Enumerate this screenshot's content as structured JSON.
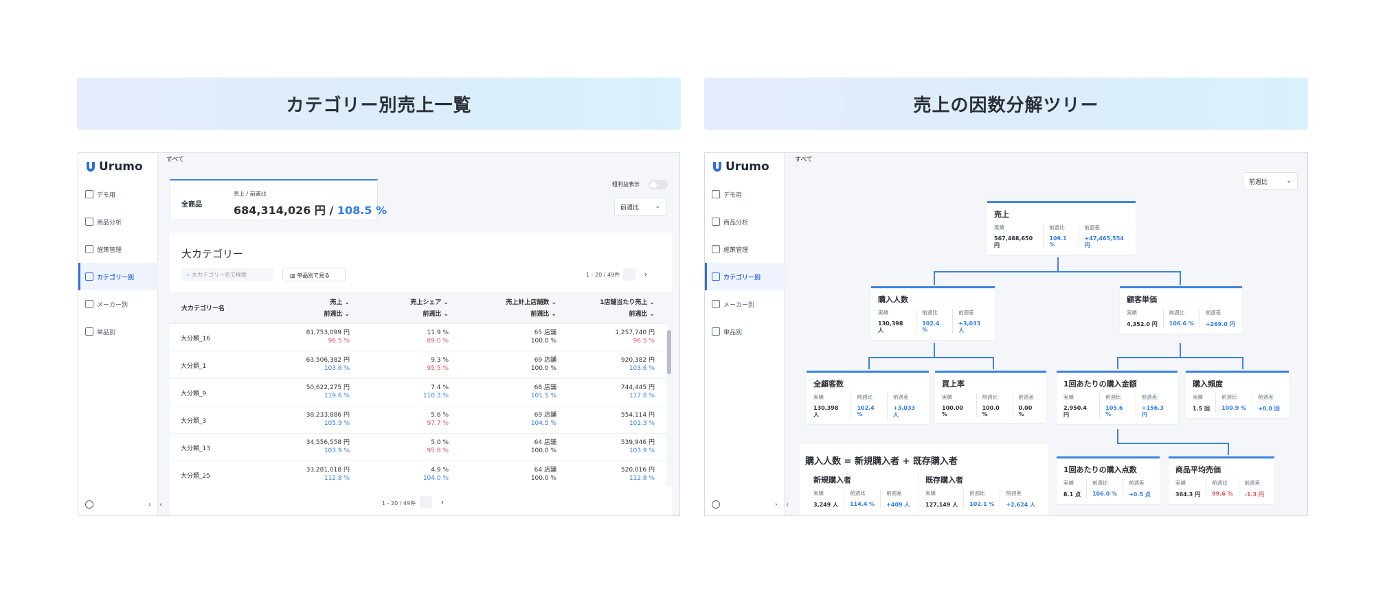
{
  "titles": {
    "left": "カテゴリー別売上一覧",
    "right": "売上の因数分解ツリー"
  },
  "colors": {
    "accent": "#2f7be8",
    "negative": "#e0505a",
    "title_bg": "#e1eefb"
  },
  "app": {
    "logo": "Urumo",
    "breadcrumb": "すべて",
    "nav": [
      {
        "label": "デモ用",
        "icon": "document-icon"
      },
      {
        "label": "商品分析",
        "icon": "chart-icon"
      },
      {
        "label": "施策管理",
        "icon": "megaphone-icon"
      },
      {
        "label": "カテゴリー別",
        "icon": "category-icon",
        "active": true
      },
      {
        "label": "メーカー別",
        "icon": "factory-icon"
      },
      {
        "label": "単品別",
        "icon": "barcode-icon"
      }
    ]
  },
  "left": {
    "summary": {
      "label": "全商品",
      "metric_label": "売上 / 前週比",
      "value": "684,314,026 円 / ",
      "ratio": "108.5 %"
    },
    "toggle_label": "粗利益表示",
    "compare_select": "前週比",
    "section_title": "大カテゴリー",
    "search_placeholder": "大カテゴリー名で検索",
    "by_item_button": "単品別で見る",
    "pagination": "1 - 20 / 49件",
    "pagination_bottom": "1 - 20 / 49件",
    "headers": {
      "name": "大カテゴリー名",
      "cols": [
        {
          "top": "売上",
          "bottom": "前週比"
        },
        {
          "top": "売上シェア",
          "bottom": "前週比"
        },
        {
          "top": "売上計上店舗数",
          "bottom": "前週比"
        },
        {
          "top": "1店舗当たり売上",
          "bottom": "前週比"
        }
      ]
    },
    "rows": [
      {
        "name": "大分類_16",
        "c": [
          [
            "81,753,099 円",
            "96.5 %",
            "red"
          ],
          [
            "11.9 %",
            "89.0 %",
            "red"
          ],
          [
            "65 店舗",
            "100.0 %",
            ""
          ],
          [
            "1,257,740 円",
            "96.5 %",
            "red"
          ]
        ]
      },
      {
        "name": "大分類_1",
        "c": [
          [
            "63,506,382 円",
            "103.6 %",
            "blue"
          ],
          [
            "9.3 %",
            "95.5 %",
            "red"
          ],
          [
            "69 店舗",
            "100.0 %",
            ""
          ],
          [
            "920,382 円",
            "103.6 %",
            "blue"
          ]
        ]
      },
      {
        "name": "大分類_9",
        "c": [
          [
            "50,622,275 円",
            "119.6 %",
            "blue"
          ],
          [
            "7.4 %",
            "110.3 %",
            "blue"
          ],
          [
            "68 店舗",
            "101.5 %",
            "blue"
          ],
          [
            "744,445 円",
            "117.8 %",
            "blue"
          ]
        ]
      },
      {
        "name": "大分類_3",
        "c": [
          [
            "38,233,886 円",
            "105.9 %",
            "blue"
          ],
          [
            "5.6 %",
            "97.7 %",
            "red"
          ],
          [
            "69 店舗",
            "104.5 %",
            "blue"
          ],
          [
            "554,114 円",
            "101.3 %",
            "blue"
          ]
        ]
      },
      {
        "name": "大分類_13",
        "c": [
          [
            "34,556,558 円",
            "103.9 %",
            "blue"
          ],
          [
            "5.0 %",
            "95.8 %",
            "red"
          ],
          [
            "64 店舗",
            "100.0 %",
            ""
          ],
          [
            "539,946 円",
            "103.9 %",
            "blue"
          ]
        ]
      },
      {
        "name": "大分類_25",
        "c": [
          [
            "33,281,018 円",
            "112.8 %",
            "blue"
          ],
          [
            "4.9 %",
            "104.0 %",
            "blue"
          ],
          [
            "64 店舗",
            "100.0 %",
            ""
          ],
          [
            "520,016 円",
            "112.8 %",
            "blue"
          ]
        ]
      }
    ]
  },
  "right": {
    "compare_select": "前週比",
    "labels": {
      "actual": "実績",
      "ratio": "前週比",
      "diff": "前週差"
    },
    "nodes": {
      "sales": {
        "title": "売上",
        "v": [
          "567,488,650 円",
          "109.1 %",
          "+47,465,554 円"
        ]
      },
      "buyers": {
        "title": "購入人数",
        "v": [
          "130,398 人",
          "102.4 %",
          "+3,033 人"
        ]
      },
      "unit": {
        "title": "顧客単価",
        "v": [
          "4,352.0 円",
          "106.6 %",
          "+269.0 円"
        ]
      },
      "customers": {
        "title": "全顧客数",
        "v": [
          "130,398 人",
          "102.4 %",
          "+3,033 人"
        ]
      },
      "buyrate": {
        "title": "買上率",
        "v": [
          "100.00 %",
          "100.0 %",
          "0.00 %"
        ]
      },
      "perbuy": {
        "title": "1回あたりの購入金額",
        "v": [
          "2,950.4 円",
          "105.6 %",
          "+156.3 円"
        ]
      },
      "freq": {
        "title": "購入頻度",
        "v": [
          "1.5 回",
          "100.9 %",
          "+0.0 回"
        ]
      },
      "items": {
        "title": "1回あたりの購入点数",
        "v": [
          "8.1 点",
          "106.0 %",
          "+0.5 点"
        ]
      },
      "avgprice": {
        "title": "商品平均売価",
        "v": [
          "364.3 円",
          "99.6 %",
          "-1.3 円"
        ]
      }
    },
    "breakdown": {
      "formula": "購入人数 = 新規購入者 + 既存購入者",
      "new": {
        "title": "新規購入者",
        "v": [
          "3,249 人",
          "114.4 %",
          "+409 人"
        ]
      },
      "existing": {
        "title": "既存購入者",
        "v": [
          "127,149 人",
          "102.1 %",
          "+2,624 人"
        ]
      }
    }
  }
}
